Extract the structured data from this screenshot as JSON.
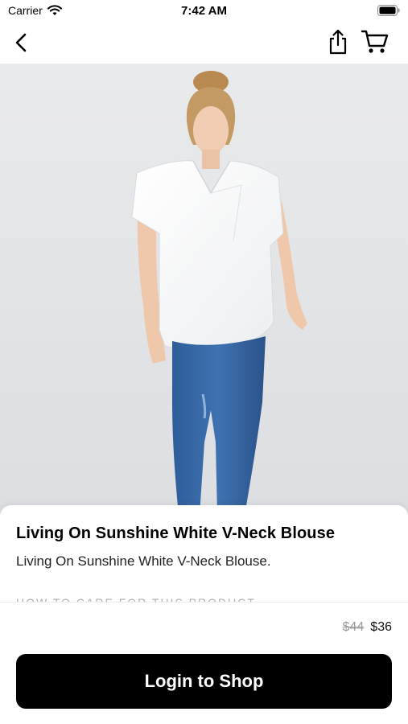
{
  "status_bar": {
    "carrier": "Carrier",
    "time": "7:42 AM",
    "icons": [
      "wifi-icon",
      "battery-icon"
    ]
  },
  "nav_bar": {
    "icons": [
      "back-chevron-icon",
      "share-icon",
      "cart-icon"
    ]
  },
  "product": {
    "title": "Living On Sunshine White V-Neck Blouse",
    "description": "Living On Sunshine White V-Neck Blouse.",
    "care_heading": "HOW TO CARE FOR THIS PRODUCT",
    "price_original": "$44",
    "price_sale": "$36"
  },
  "actions": {
    "login_label": "Login to Shop"
  },
  "colors": {
    "accent": "#000000",
    "image_background": "#e6e7e9",
    "muted_text": "#9a9a9a"
  }
}
